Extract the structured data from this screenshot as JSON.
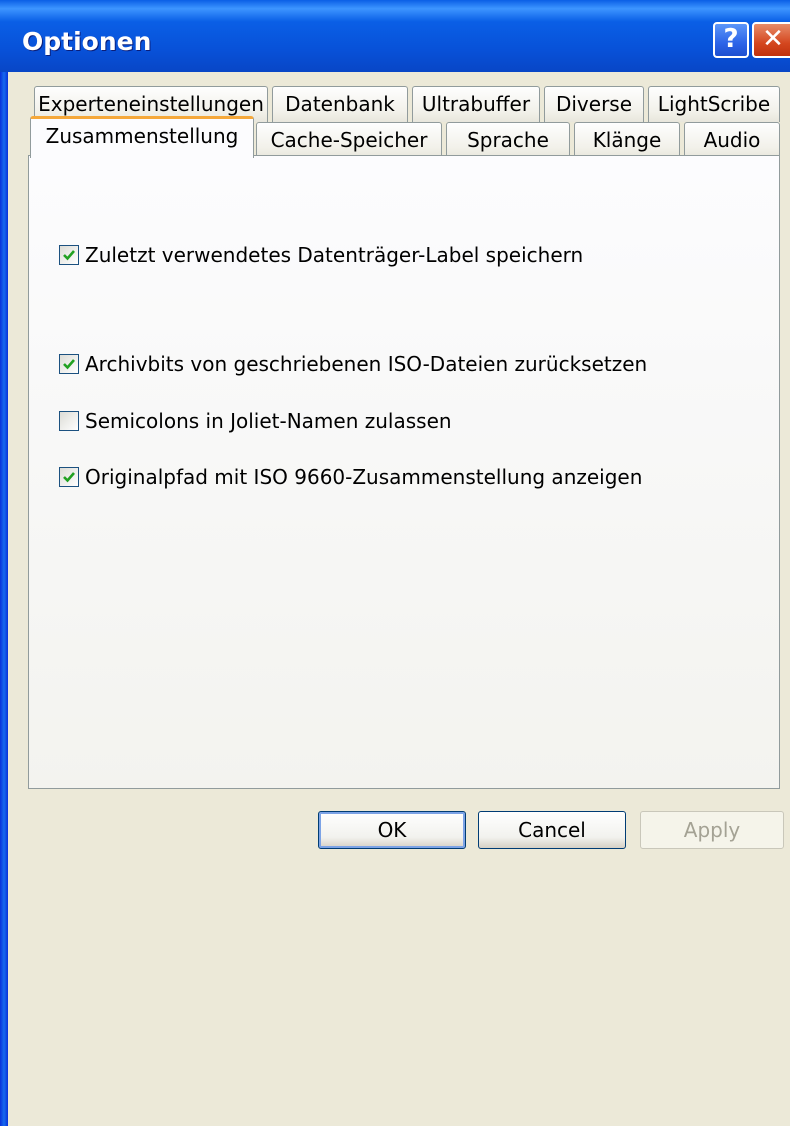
{
  "window": {
    "title": "Optionen"
  },
  "titlebar": {
    "help_glyph": "?",
    "close_glyph": "✕"
  },
  "tabs": {
    "row1": [
      {
        "label": "Experteneinstellungen"
      },
      {
        "label": "Datenbank"
      },
      {
        "label": "Ultrabuffer"
      },
      {
        "label": "Diverse"
      },
      {
        "label": "LightScribe"
      }
    ],
    "row2": [
      {
        "label": "Zusammenstellung",
        "active": true
      },
      {
        "label": "Cache-Speicher"
      },
      {
        "label": "Sprache"
      },
      {
        "label": "Klänge"
      },
      {
        "label": "Audio"
      }
    ]
  },
  "options": [
    {
      "label": "Zuletzt verwendetes Datenträger-Label speichern",
      "checked": true
    },
    {
      "label": "Archivbits von geschriebenen ISO-Dateien zurücksetzen",
      "checked": true
    },
    {
      "label": "Semicolons in Joliet-Namen zulassen",
      "checked": false
    },
    {
      "label": "Originalpfad mit ISO 9660-Zusammenstellung anzeigen",
      "checked": true
    }
  ],
  "buttons": {
    "ok": "OK",
    "cancel": "Cancel",
    "apply": "Apply"
  },
  "colors": {
    "check": "#21a121",
    "tab_highlight": "#f5a83a",
    "titlebar": "#0a5fe6"
  }
}
